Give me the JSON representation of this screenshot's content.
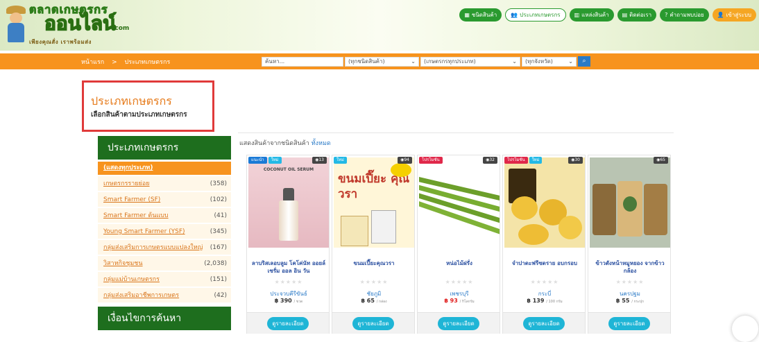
{
  "header": {
    "logo_top": "ตลาดเกษตรกร",
    "logo_main": "ออนไลน์",
    "logo_com": ".com",
    "logo_sub": "เพียงคุณสั่ง เราพร้อมส่ง",
    "nav": [
      {
        "label": "ชนิดสินค้า",
        "icon": "▦"
      },
      {
        "label": "ประเภทเกษตรกร",
        "icon": "👥"
      },
      {
        "label": "แหล่งสินค้า",
        "icon": "▥"
      },
      {
        "label": "ติดต่อเรา",
        "icon": "▤"
      },
      {
        "label": "คำถามพบบ่อย",
        "icon": "?"
      },
      {
        "label": "เข้าสู่ระบบ",
        "icon": "👤"
      }
    ]
  },
  "breadcrumb": {
    "home": "หน้าแรก",
    "sep": ">",
    "current": "ประเภทเกษตรกร"
  },
  "search": {
    "keyword_placeholder": "ค้นหา...",
    "product_type": "(ทุกชนิดสินค้า)",
    "farmer_type": "(เกษตรกรทุกประเภท)",
    "province": "(ทุกจังหวัด)"
  },
  "page": {
    "title": "ประเภทเกษตรกร",
    "subtitle": "เลือกสินค้าตามประเภทเกษตรกร"
  },
  "sidebar": {
    "heading": "ประเภทเกษตรกร",
    "all_label": "(แสดงทุกประเภท)",
    "items": [
      {
        "label": "เกษตรกรรายย่อย",
        "count": "(358)"
      },
      {
        "label": "Smart Farmer (SF)",
        "count": "(102)"
      },
      {
        "label": "Smart Farmer ต้นแบบ",
        "count": "(41)"
      },
      {
        "label": "Young Smart Farmer (YSF)",
        "count": "(345)"
      },
      {
        "label": "กลุ่มส่งเสริมการเกษตรแบบแปลงใหญ่",
        "count": "(167)"
      },
      {
        "label": "วิสาหกิจชุมชน",
        "count": "(2,038)"
      },
      {
        "label": "กลุ่มแม่บ้านเกษตรกร",
        "count": "(151)"
      },
      {
        "label": "กลุ่มส่งเสริมอาชีพการเกษตร",
        "count": "(42)"
      }
    ],
    "search_heading": "เงื่อนไขการค้นหา"
  },
  "listing": {
    "prefix": "แสดงสินค้าจากชนิดสินค้า",
    "link": "ทั้งหมด"
  },
  "products": [
    {
      "badges": [
        {
          "text": "แนะนำ",
          "color": "blue"
        },
        {
          "text": "ใหม่",
          "color": "cyan"
        }
      ],
      "views": "13",
      "name": "ลาบริสเลอบลูม โคโค่นัท ออยล์ เซรั่ม ออล อิน วัน",
      "stars": "★★★★★",
      "province": "ประจวบคีรีขันธ์",
      "price": "฿ 390",
      "unit": "/ ขวด",
      "price_red": false,
      "detail": "ดูรายละเอียด",
      "img_text": "COCONUT OIL SERUM"
    },
    {
      "badges": [
        {
          "text": "ใหม่",
          "color": "cyan"
        }
      ],
      "views": "94",
      "name": "ขนมเปี๊ยะคุณวรา",
      "stars": "★★★★★",
      "province": "ชัยภูมิ",
      "price": "฿ 65",
      "unit": "/ กล่อง",
      "price_red": false,
      "detail": "ดูรายละเอียด",
      "img_text": "ขนมเปี๊ยะ คุณวรา"
    },
    {
      "badges": [
        {
          "text": "โปรโมชั่น",
          "color": "red"
        }
      ],
      "views": "32",
      "name": "หน่อไม้ฝรั่ง",
      "stars": "★★★★★",
      "province": "เพชรบุรี",
      "price": "฿ 93",
      "unit": "/ กิโลกรัม",
      "price_red": true,
      "detail": "ดูรายละเอียด",
      "img_text": ""
    },
    {
      "badges": [
        {
          "text": "โปรโมชั่น",
          "color": "red"
        },
        {
          "text": "ใหม่",
          "color": "cyan"
        }
      ],
      "views": "30",
      "name": "จำปาดะฟรีซดราย อบกรอบ",
      "stars": "★★★★★",
      "province": "กระบี่",
      "price": "฿ 139",
      "unit": "/ 100 กรัม",
      "price_red": false,
      "detail": "ดูรายละเอียด",
      "img_text": ""
    },
    {
      "badges": [],
      "views": "65",
      "name": "ข้าวตังหน้าหมูหยอง จากข้าวกล้อง",
      "stars": "★★★★★",
      "province": "นครปฐม",
      "price": "฿ 55",
      "unit": "/ กระปุก",
      "price_red": false,
      "detail": "ดูรายละเอียด",
      "img_text": ""
    }
  ],
  "colors": {
    "orange": "#f7931e",
    "green": "#1e6e1e",
    "cyan": "#1fb5d6",
    "title_orange": "#e67a1a",
    "highlight_red": "#e03a3a"
  }
}
